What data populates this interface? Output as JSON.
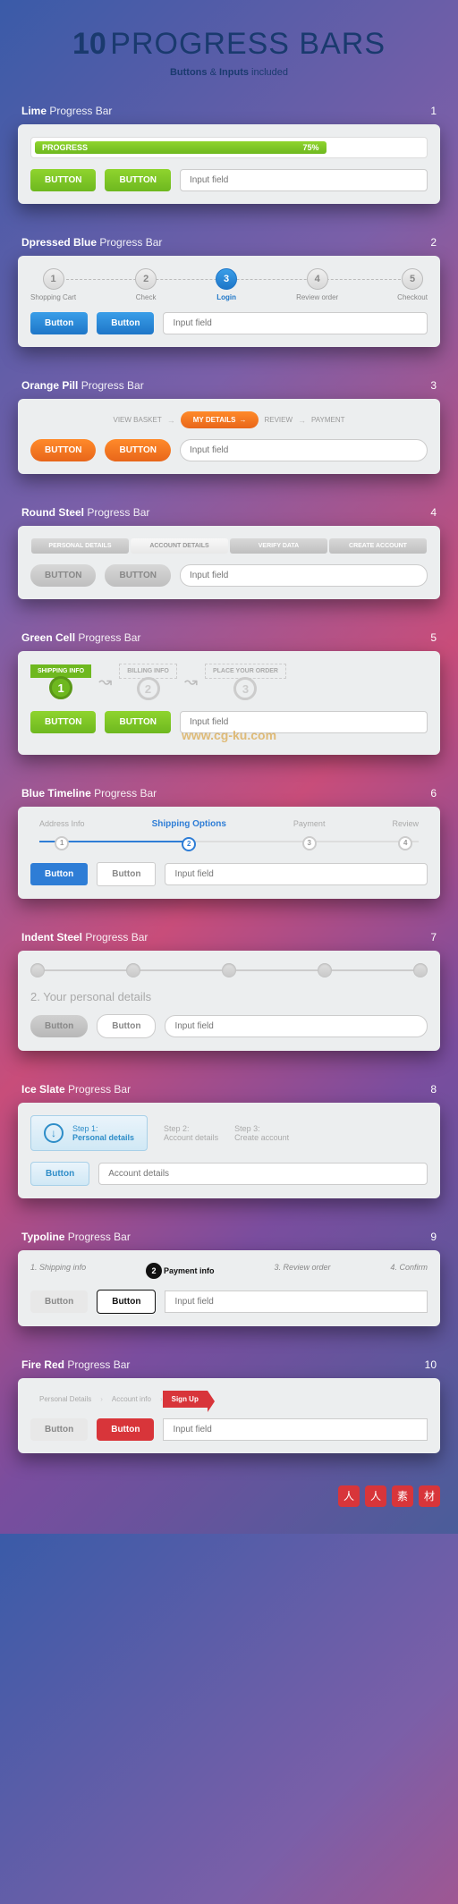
{
  "header": {
    "number": "10",
    "title": "PROGRESS BARS",
    "sub_prefix": "Buttons",
    "sub_amp": "&",
    "sub_suffix": "Inputs",
    "sub_tail": "included"
  },
  "sections": {
    "lime": {
      "name_bold": "Lime",
      "name_rest": "Progress Bar",
      "idx": "1",
      "progress_label": "PROGRESS",
      "progress_pct": "75%",
      "btn1": "BUTTON",
      "btn2": "BUTTON",
      "placeholder": "Input field"
    },
    "dblue": {
      "name_bold": "Dpressed Blue",
      "name_rest": "Progress Bar",
      "idx": "2",
      "steps": [
        {
          "n": "1",
          "lbl": "Shopping Cart"
        },
        {
          "n": "2",
          "lbl": "Check"
        },
        {
          "n": "3",
          "lbl": "Login"
        },
        {
          "n": "4",
          "lbl": "Review order"
        },
        {
          "n": "5",
          "lbl": "Checkout"
        }
      ],
      "active": 2,
      "btn1": "Button",
      "btn2": "Button",
      "placeholder": "Input field"
    },
    "orange": {
      "name_bold": "Orange Pill",
      "name_rest": "Progress Bar",
      "idx": "3",
      "steps": [
        "VIEW BASKET",
        "MY DETAILS",
        "REVIEW",
        "PAYMENT"
      ],
      "active": 1,
      "btn1": "BUTTON",
      "btn2": "BUTTON",
      "placeholder": "Input field"
    },
    "steel": {
      "name_bold": "Round Steel",
      "name_rest": "Progress Bar",
      "idx": "4",
      "tabs": [
        "PERSONAL DETAILS",
        "ACCOUNT DETAILS",
        "VERIFY DATA",
        "CREATE ACCOUNT"
      ],
      "active": 1,
      "btn1": "BUTTON",
      "btn2": "BUTTON",
      "placeholder": "Input field"
    },
    "gcell": {
      "name_bold": "Green Cell",
      "name_rest": "Progress Bar",
      "idx": "5",
      "steps": [
        {
          "lbl": "SHIPPING INFO",
          "n": "1"
        },
        {
          "lbl": "BILLING INFO",
          "n": "2"
        },
        {
          "lbl": "PLACE YOUR ORDER",
          "n": "3"
        }
      ],
      "active": 0,
      "btn1": "BUTTON",
      "btn2": "BUTTON",
      "placeholder": "Input field",
      "watermark": "www.cg-ku.com"
    },
    "bluetl": {
      "name_bold": "Blue Timeline",
      "name_rest": "Progress Bar",
      "idx": "6",
      "steps": [
        {
          "lbl": "Address Info",
          "n": "1"
        },
        {
          "lbl": "Shipping Options",
          "n": "2"
        },
        {
          "lbl": "Payment",
          "n": "3"
        },
        {
          "lbl": "Review",
          "n": "4"
        }
      ],
      "active": 1,
      "btn1": "Button",
      "btn2": "Button",
      "placeholder": "Input field"
    },
    "indent": {
      "name_bold": "Indent Steel",
      "name_rest": "Progress Bar",
      "idx": "7",
      "title": "2. Your personal details",
      "btn1": "Button",
      "btn2": "Button",
      "placeholder": "Input field"
    },
    "ice": {
      "name_bold": "Ice Slate",
      "name_rest": "Progress Bar",
      "idx": "8",
      "steps": [
        {
          "pre": "Step 1:",
          "lbl": "Personal details"
        },
        {
          "pre": "Step 2:",
          "lbl": "Account details"
        },
        {
          "pre": "Step 3:",
          "lbl": "Create account"
        }
      ],
      "btn1": "Button",
      "placeholder": "Account details"
    },
    "typo": {
      "name_bold": "Typoline",
      "name_rest": "Progress Bar",
      "idx": "9",
      "steps": [
        {
          "n": "1.",
          "lbl": "Shipping info"
        },
        {
          "n": "2",
          "lbl": "Payment info"
        },
        {
          "n": "3.",
          "lbl": "Review order"
        },
        {
          "n": "4.",
          "lbl": "Confirm"
        }
      ],
      "active": 1,
      "btn1": "Button",
      "btn2": "Button",
      "placeholder": "Input field"
    },
    "fire": {
      "name_bold": "Fire Red",
      "name_rest": "Progress Bar",
      "idx": "10",
      "steps": [
        "Personal Details",
        "Account info",
        "Sign Up"
      ],
      "active": 2,
      "btn1": "Button",
      "btn2": "Button",
      "placeholder": "Input field"
    }
  }
}
